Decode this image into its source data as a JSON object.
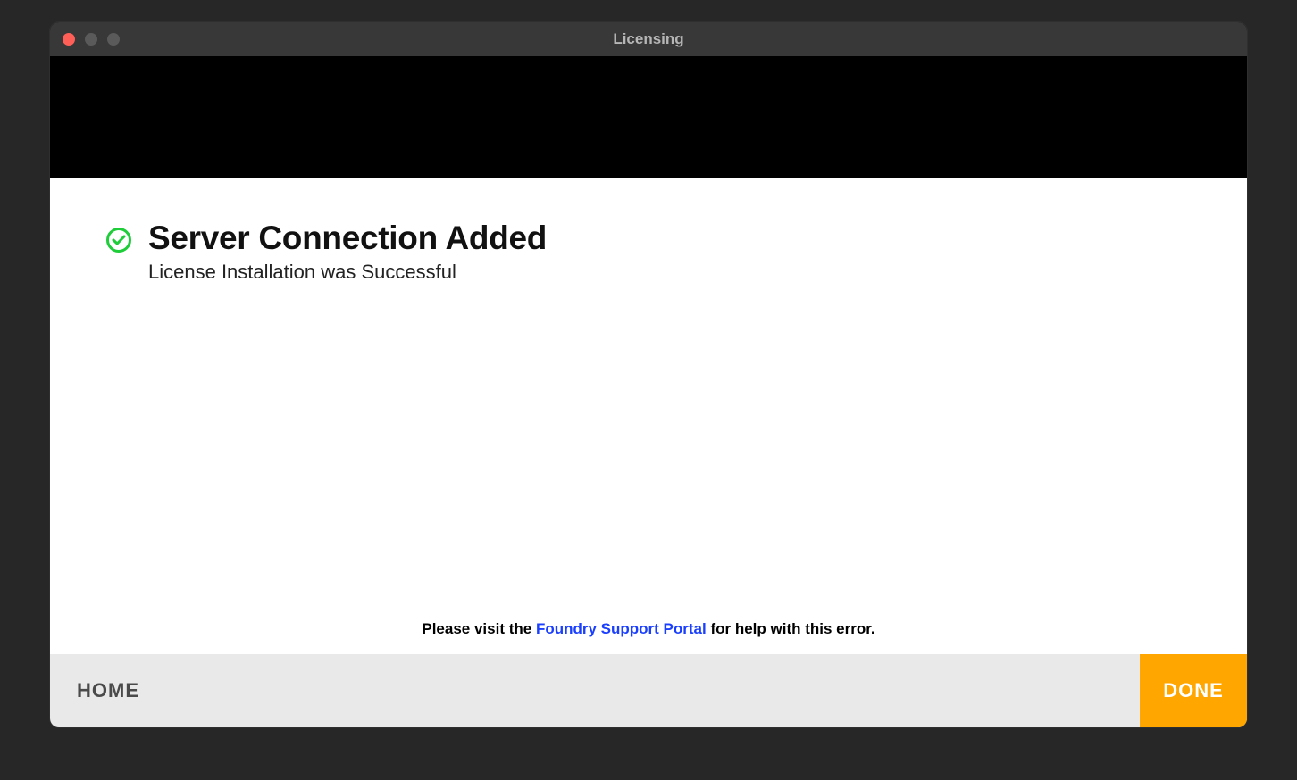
{
  "window": {
    "title": "Licensing"
  },
  "message": {
    "heading": "Server Connection Added",
    "subheading": "License Installation was Successful"
  },
  "support": {
    "prefix": "Please visit the ",
    "link_text": "Foundry Support Portal",
    "suffix": " for help with this error."
  },
  "footer": {
    "home_label": "HOME",
    "done_label": "DONE"
  },
  "colors": {
    "accent": "#ffa600",
    "success": "#1fcc3a"
  }
}
